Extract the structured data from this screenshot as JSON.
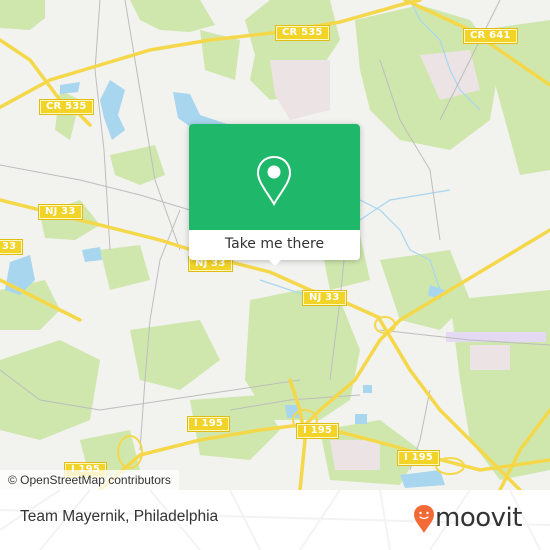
{
  "map": {
    "colors": {
      "background": "#f2f2ef",
      "green": "#cfe7ad",
      "water": "#a8d6ef",
      "road_major": "#f4d84a",
      "road_minor": "#b9b9b9",
      "landuse": "#ece4e4"
    },
    "road_shields": [
      {
        "id": "cr535-top",
        "label": "CR 535"
      },
      {
        "id": "cr535-left",
        "label": "CR 535"
      },
      {
        "id": "cr641",
        "label": "CR 641"
      },
      {
        "id": "nj33-left",
        "label": "NJ 33"
      },
      {
        "id": "nj33-center",
        "label": "NJ 33"
      },
      {
        "id": "nj33-partial",
        "label": "NJ 33"
      },
      {
        "id": "edge-33",
        "label": "33"
      },
      {
        "id": "i195-a",
        "label": "I 195"
      },
      {
        "id": "i195-b",
        "label": "I 195"
      },
      {
        "id": "i195-c",
        "label": "I 195"
      },
      {
        "id": "i195-d",
        "label": "I 195"
      }
    ],
    "attribution": "© OpenStreetMap contributors"
  },
  "popup": {
    "icon": "map-pin-icon",
    "action_label": "Take me there",
    "accent": "#1fb86b"
  },
  "footer": {
    "place_name": "Team Mayernik, Philadelphia",
    "brand": {
      "name": "moovit",
      "icon": "moovit-logo-pin-icon",
      "accent": "#f26a35"
    }
  }
}
